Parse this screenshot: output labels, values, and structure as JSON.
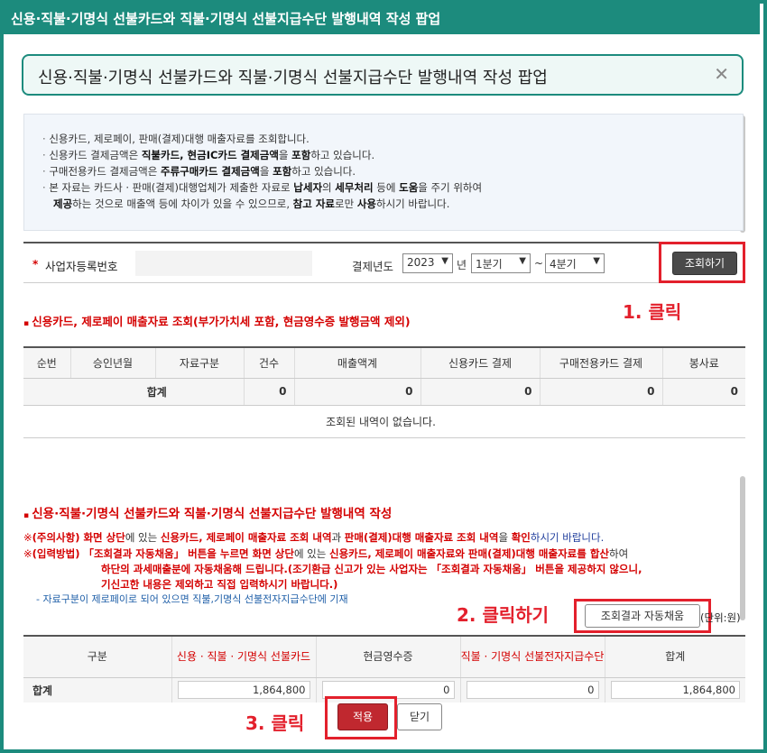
{
  "window": {
    "title": "신용·직불·기명식 선불카드와 직불·기명식 선불지급수단 발행내역 작성 팝업"
  },
  "popup": {
    "title": "신용·직불·기명식 선불카드와 직불·기명식 선불지급수단 발행내역 작성 팝업",
    "close_glyph": "✕"
  },
  "notice": {
    "l1": "신용카드, 제로페이, 판매(결제)대행 매출자료를 조회합니다.",
    "l2a": "신용카드 결제금액은 ",
    "l2b": "직불카드, 현금IC카드 결제금액",
    "l2c": "을 ",
    "l2d": "포함",
    "l2e": "하고 있습니다.",
    "l3a": "구매전용카드 결제금액은 ",
    "l3b": "주류구매카드 결제금액",
    "l3c": "을 ",
    "l3d": "포함",
    "l3e": "하고 있습니다.",
    "l4a": "본 자료는 카드사 · 판매(결제)대행업체가 제출한 자료로 ",
    "l4b": "납세자",
    "l4c": "의 ",
    "l4d": "세무처리",
    "l4e": " 등에 ",
    "l4f": "도움",
    "l4g": "을 주기 위하여",
    "l5a": "제공",
    "l5b": "하는 것으로 매출액 등에 차이가 있을 수 있으므로, ",
    "l5c": "참고 자료",
    "l5d": "로만 ",
    "l5e": "사용",
    "l5f": "하시기 바랍니다."
  },
  "search": {
    "required_mark": "*",
    "bizno_label": "사업자등록번호",
    "bizno_value": "",
    "year_label": "결제년도",
    "year_value": "2023",
    "year_unit": "년",
    "q_from": "1분기",
    "tilde": "~",
    "q_to": "4분기",
    "button": "조회하기"
  },
  "annotations": {
    "a1": "1. 클릭",
    "a2": "2. 클릭하기",
    "a3": "3. 클릭"
  },
  "section1": {
    "title": "신용카드, 제로페이 매출자료 조회(부가가치세 포함, 현금영수증 발행금액 제외)",
    "headers": [
      "순번",
      "승인년월",
      "자료구분",
      "건수",
      "매출액계",
      "신용카드 결제",
      "구매전용카드 결제",
      "봉사료"
    ],
    "total_label": "합계",
    "totals": [
      "0",
      "0",
      "0",
      "0",
      "0"
    ],
    "empty_msg": "조회된 내역이 없습니다."
  },
  "section2": {
    "title": "신용·직불·기명식 선불카드와 직불·기명식 선불지급수단 발행내역 작성",
    "warn1_mark": "※",
    "warn1_a": "(주의사항) 화면 상단",
    "warn1_b": "에 있는 ",
    "warn1_c": "신용카드, 제로페이 매출자료 조회 내역",
    "warn1_d": "과 ",
    "warn1_e": "판매(결제)대행 매출자료 조회 내역",
    "warn1_f": "을 ",
    "warn1_g": "확인",
    "warn1_h": "하시기 바랍니다.",
    "warn2_mark": "※",
    "warn2_a": "(입력방법) 「조회결과 자동채움」 버튼을 누르면 화면 상단",
    "warn2_b": "에 있는 ",
    "warn2_c": "신용카드, 제로페이 매출자료와 판매(결제)대행 매출자료를 합산",
    "warn2_d": "하여",
    "warn2_l2a": "하단의 과세매출분",
    "warn2_l2b": "에 자동채움해 드립니다.(조기환급 신고가 있는 사업자는 「조회결과 자동채움」 버튼을 제공하지 않으니,",
    "warn2_l3": "기신고한 내용은 제외하고 직접 입력하시기 바랍니다.)",
    "note": "- 자료구분이 제로페이로 되어 있으면 직불,기명식 선불전자지급수단에 기재",
    "auto_button": "조회결과 자동채움",
    "unit": "(단위:원)",
    "headers": [
      "구분",
      "신용 · 직불 · 기명식 선불카드",
      "현금영수증",
      "직불 · 기명식 선불전자지급수단",
      "합계"
    ],
    "total_label": "합계",
    "totals": [
      "1,864,800",
      "0",
      "0",
      "1,864,800"
    ]
  },
  "footer": {
    "apply": "적용",
    "close": "닫기"
  }
}
